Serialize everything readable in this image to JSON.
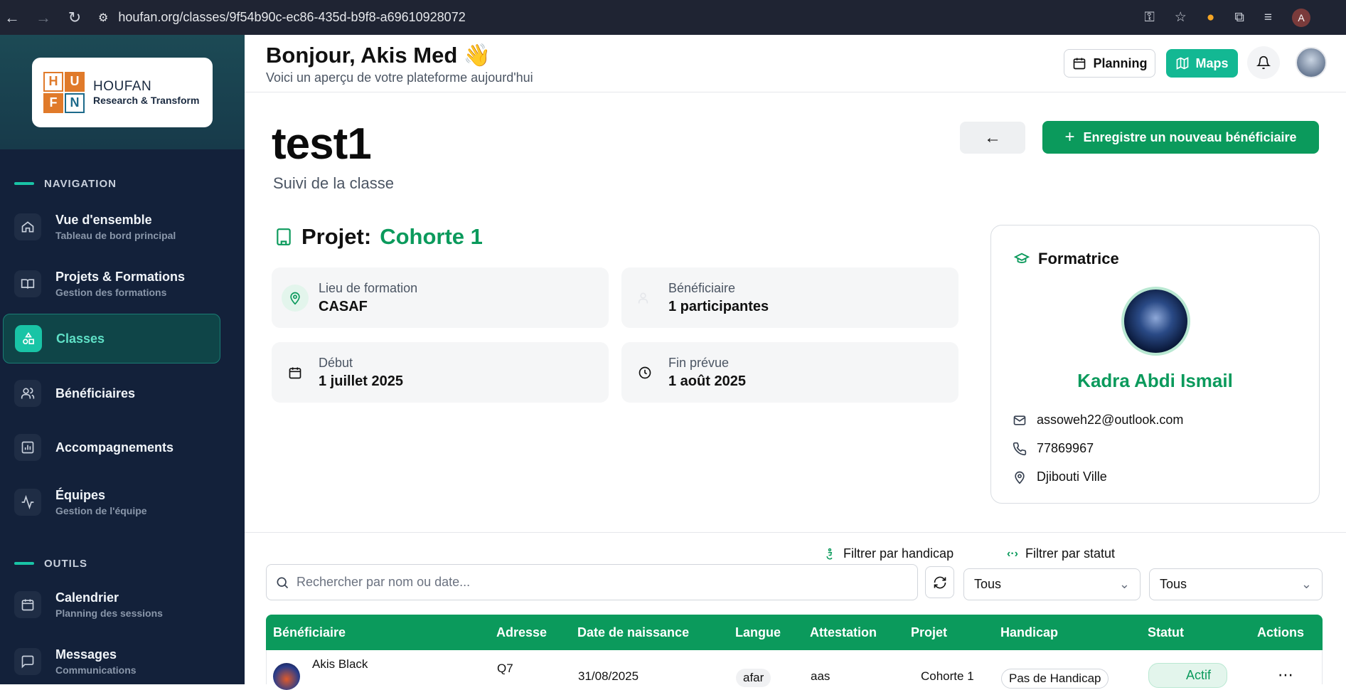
{
  "browser": {
    "url": "houfan.org/classes/9f54b90c-ec86-435d-b9f8-a69610928072",
    "profile_initial": "A"
  },
  "sidebar": {
    "logo": {
      "letters": [
        "H",
        "U",
        "F",
        "N"
      ],
      "name": "HOUFAN",
      "tagline": "Research & Transform"
    },
    "section_navigation": "NAVIGATION",
    "section_tools": "OUTILS",
    "items": [
      {
        "title": "Vue d'ensemble",
        "subtitle": "Tableau de bord principal",
        "icon": "home-icon"
      },
      {
        "title": "Projets & Formations",
        "subtitle": "Gestion des formations",
        "icon": "book-icon"
      },
      {
        "title": "Classes",
        "subtitle": "",
        "icon": "shapes-icon",
        "active": true
      },
      {
        "title": "Bénéficiaires",
        "subtitle": "",
        "icon": "users-icon"
      },
      {
        "title": "Accompagnements",
        "subtitle": "",
        "icon": "chart-icon"
      },
      {
        "title": "Équipes",
        "subtitle": "Gestion de l'équipe",
        "icon": "activity-icon"
      },
      {
        "title": "Calendrier",
        "subtitle": "Planning des sessions",
        "icon": "calendar-icon"
      },
      {
        "title": "Messages",
        "subtitle": "Communications",
        "icon": "message-icon"
      }
    ]
  },
  "header": {
    "greeting": "Bonjour, Akis Med 👋",
    "subtitle": "Voici un aperçu de votre plateforme aujourd'hui",
    "planning_label": "Planning",
    "maps_label": "Maps"
  },
  "page": {
    "title": "test1",
    "subtitle": "Suivi de la classe",
    "back_label": "←",
    "new_button_label": "Enregistre un nouveau bénéficiaire",
    "projet_label": "Projet:",
    "projet_value": "Cohorte 1"
  },
  "info": {
    "lieu_label": "Lieu de formation",
    "lieu_value": "CASAF",
    "benef_label": "Bénéficiaire",
    "benef_value": "1 participantes",
    "debut_label": "Début",
    "debut_value": "1 juillet 2025",
    "fin_label": "Fin prévue",
    "fin_value": "1 août 2025"
  },
  "formatrice": {
    "heading": "Formatrice",
    "name": "Kadra Abdi Ismail",
    "email": "assoweh22@outlook.com",
    "phone": "77869967",
    "location": "Djibouti Ville"
  },
  "filters": {
    "search_placeholder": "Rechercher par nom ou date...",
    "handicap_label": "Filtrer par handicap",
    "handicap_value": "Tous",
    "statut_label": "Filtrer par statut",
    "statut_value": "Tous"
  },
  "table": {
    "columns": [
      "Bénéficiaire",
      "Adresse",
      "Date de naissance",
      "Langue",
      "Attestation",
      "Projet",
      "Handicap",
      "Statut",
      "Actions"
    ],
    "rows": [
      {
        "name": "Akis Black",
        "adresse": "Q7",
        "naissance": "31/08/2025",
        "langue": "afar",
        "attestation": "aas",
        "projet": "Cohorte 1",
        "handicap": "Pas de Handicap",
        "statut": "Actif",
        "actions": "⋯"
      }
    ]
  },
  "colors": {
    "accent": "#0b9a5c",
    "teal": "#19c4a6",
    "sidebar": "#13213a"
  }
}
